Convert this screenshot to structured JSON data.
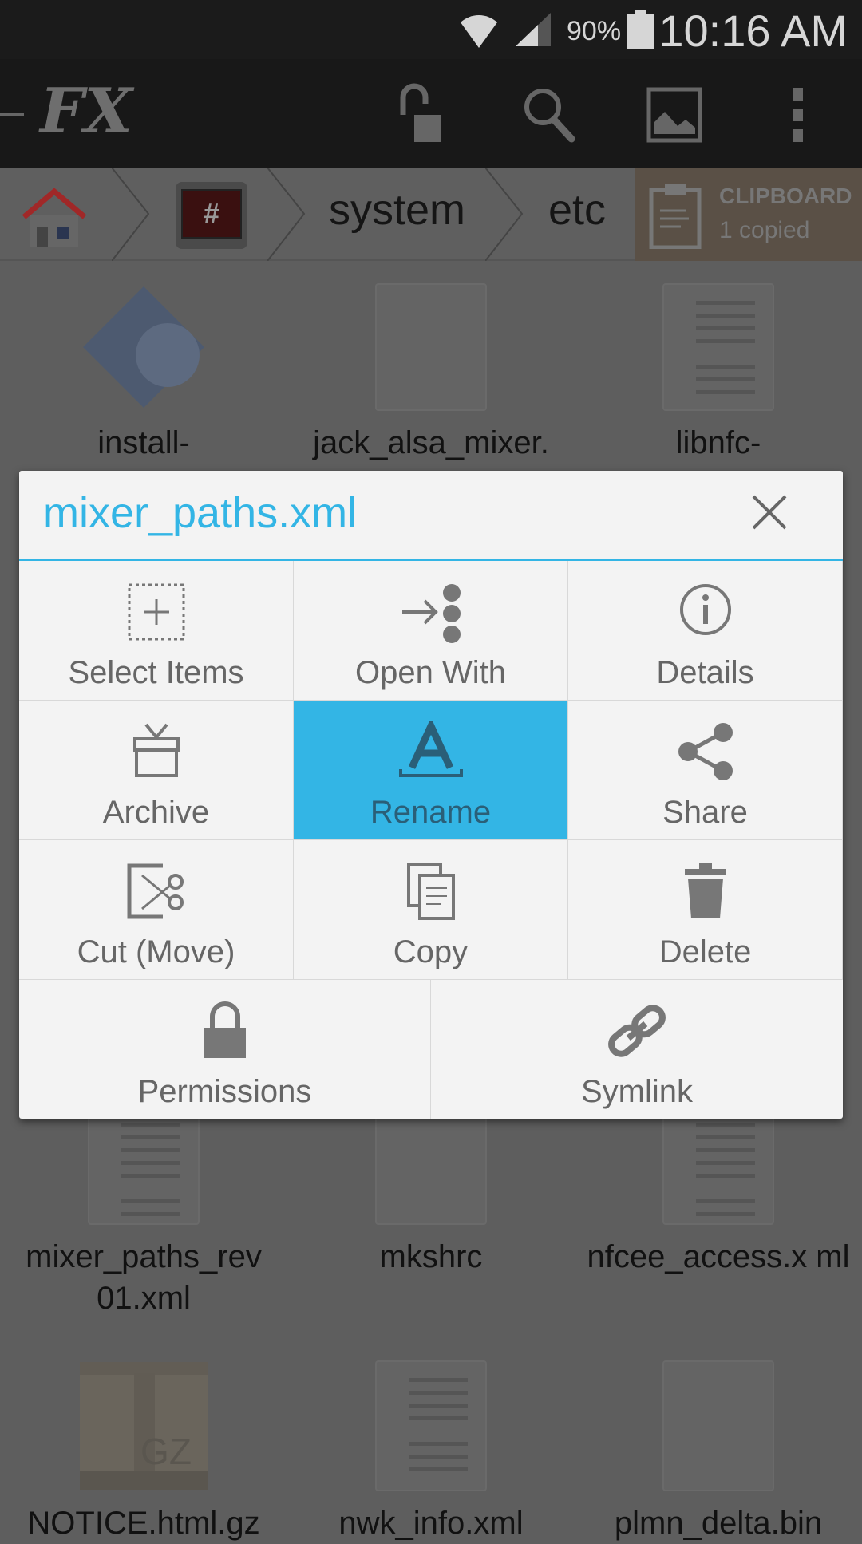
{
  "status": {
    "battery": "90%",
    "time": "10:16 AM"
  },
  "app": {
    "logo": "FX"
  },
  "breadcrumb": {
    "items": [
      "system",
      "etc"
    ],
    "clipboard_title": "CLIPBOARD",
    "clipboard_count": "1 copied"
  },
  "files": [
    {
      "name": "install-"
    },
    {
      "name": "jack_alsa_mixer."
    },
    {
      "name": "libnfc-"
    },
    {
      "name": "mixer_paths_rev 01.xml"
    },
    {
      "name": "mkshrc"
    },
    {
      "name": "nfcee_access.x ml"
    },
    {
      "name": "NOTICE.html.gz"
    },
    {
      "name": "nwk_info.xml"
    },
    {
      "name": "plmn_delta.bin"
    }
  ],
  "dialog": {
    "title": "mixer_paths.xml",
    "actions": [
      {
        "label": "Select Items",
        "icon": "select-icon"
      },
      {
        "label": "Open With",
        "icon": "open-with-icon"
      },
      {
        "label": "Details",
        "icon": "info-icon"
      },
      {
        "label": "Archive",
        "icon": "archive-icon"
      },
      {
        "label": "Rename",
        "icon": "rename-icon",
        "selected": true
      },
      {
        "label": "Share",
        "icon": "share-icon"
      },
      {
        "label": "Cut (Move)",
        "icon": "cut-icon"
      },
      {
        "label": "Copy",
        "icon": "copy-icon"
      },
      {
        "label": "Delete",
        "icon": "trash-icon"
      },
      {
        "label": "Permissions",
        "icon": "lock-icon"
      },
      {
        "label": "Symlink",
        "icon": "link-icon"
      }
    ]
  },
  "colors": {
    "accent": "#33b5e5"
  }
}
